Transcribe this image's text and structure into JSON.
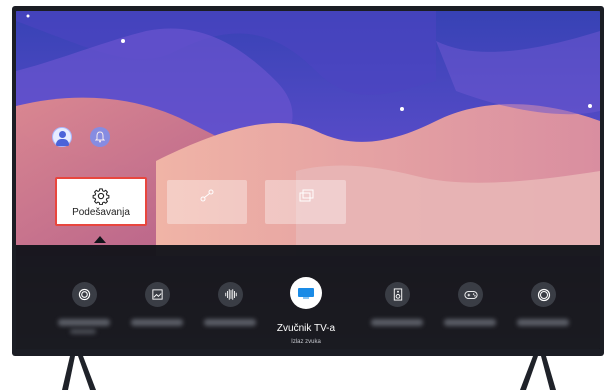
{
  "tiles": {
    "settings_label": "Podešavanja"
  },
  "sound_output": {
    "selected_label": "Zvučnik TV-a",
    "sub_label": "Izlaz zvuka"
  },
  "icons": {
    "profile": "user-avatar-icon",
    "notifications": "bell-icon",
    "settings": "gear-icon",
    "source": "source-icon",
    "multiview": "multi-window-icon"
  },
  "colors": {
    "highlight_border": "#e8463e",
    "panel_bg": "#12141a",
    "accent_blue": "#1a8be6"
  }
}
